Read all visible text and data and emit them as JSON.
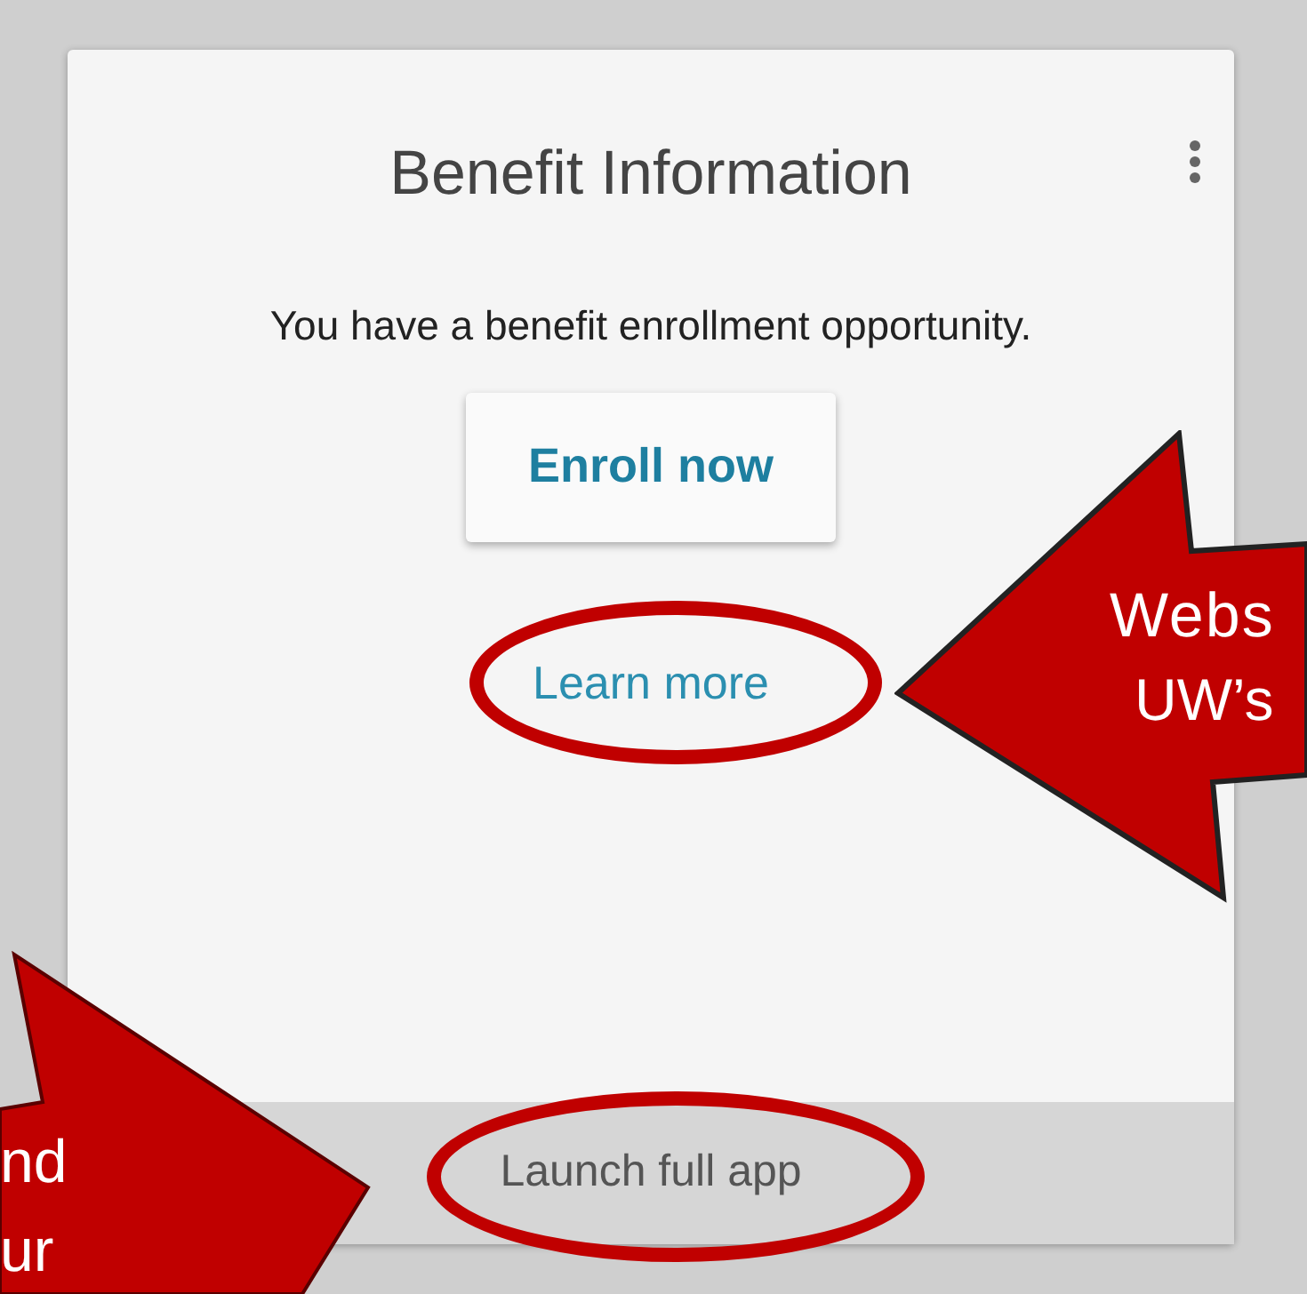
{
  "card": {
    "title": "Benefit Information",
    "message": "You have a benefit enrollment opportunity.",
    "primary_button": "Enroll now",
    "link": {
      "label": "Learn more",
      "circled": true
    },
    "footer_link": {
      "label": "Launch full app",
      "circled": true
    }
  },
  "annotations": [
    {
      "kind": "arrow-left",
      "lines": [
        "Webs",
        "UW’s"
      ]
    },
    {
      "kind": "arrow-down-right",
      "lines": [
        "nd",
        "ur"
      ]
    }
  ]
}
